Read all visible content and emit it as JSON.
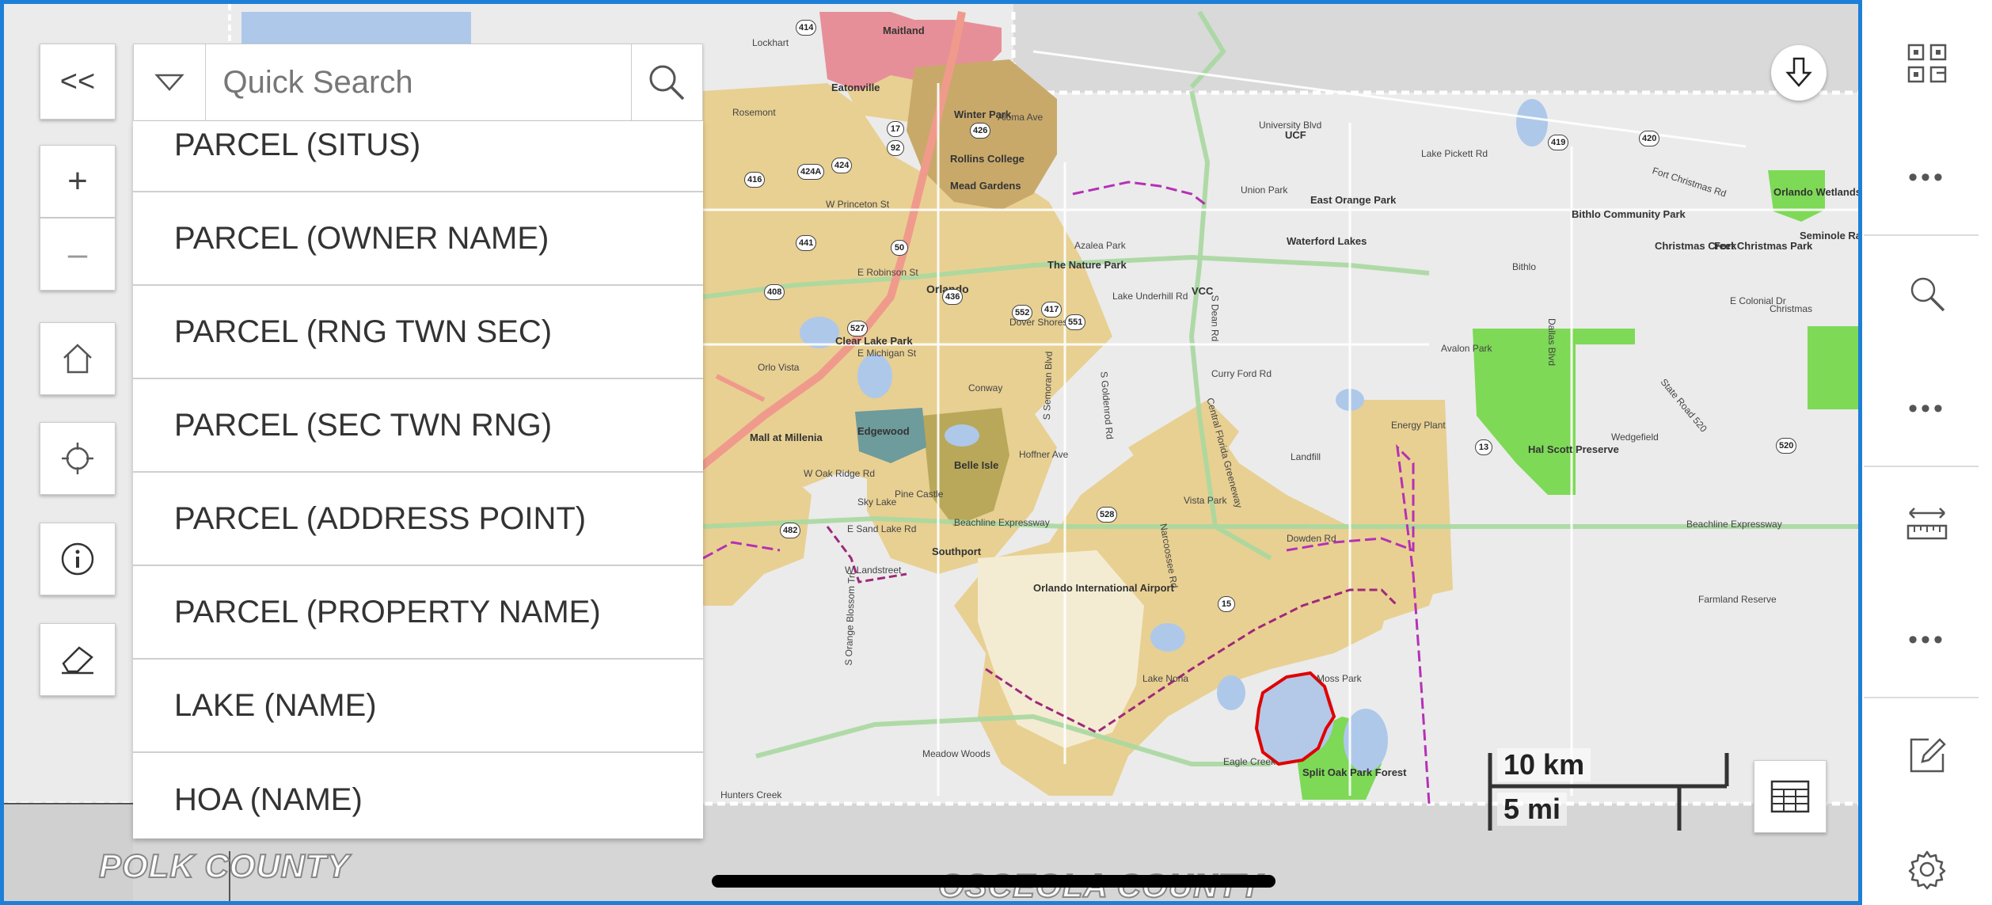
{
  "search": {
    "placeholder": "Quick Search",
    "items": [
      "PARCEL (SITUS)",
      "PARCEL (OWNER NAME)",
      "PARCEL (RNG TWN SEC)",
      "PARCEL (SEC TWN RNG)",
      "PARCEL (ADDRESS POINT)",
      "PARCEL (PROPERTY NAME)",
      "LAKE (NAME)",
      "HOA (NAME)"
    ]
  },
  "map_controls": {
    "collapse_label": "<<",
    "zoom_in_label": "+",
    "zoom_out_label": "–"
  },
  "map": {
    "counties": [
      "POLK COUNTY",
      "OSCEOLA COUNTY"
    ],
    "places": [
      "Maitland",
      "Eatonville",
      "Winter Park",
      "Rollins College",
      "Mead Gardens",
      "Orlando",
      "Clear Lake Park",
      "Edgewood",
      "Belle Isle",
      "Mall at Millenia",
      "The Nature Park",
      "Azalea Park",
      "Union Park",
      "East Orange Park",
      "Waterford Lakes",
      "Bithlo",
      "Bithlo Community Park",
      "Christmas",
      "Christmas Creek",
      "Fort Christmas Park",
      "Orlando Wetlands Park",
      "Seminole Ranch Conservation Area",
      "Hal Scott Preserve",
      "Wedgefield",
      "Orlando International Airport",
      "Southport",
      "Lake Nona",
      "Moss Park",
      "Split Oak Park Forest",
      "Eagle Creek",
      "Meadow Woods",
      "Landfill",
      "Vista Park",
      "Energy Plant",
      "Farmland Reserve",
      "Hunters Creek",
      "Avalon Park",
      "Lockhart",
      "Rosemont",
      "Conway",
      "UCF",
      "VCC",
      "Orlo Vista",
      "Dover Shores",
      "Pine Castle",
      "Sky Lake"
    ],
    "roads": [
      "University Blvd",
      "Lake Pickett Rd",
      "Fort Christmas Rd",
      "E Colonial Dr",
      "E Robinson St",
      "E Michigan St",
      "Lake Underhill Rd",
      "Curry Ford Rd",
      "Hoffner Ave",
      "W Oak Ridge Rd",
      "E Sand Lake Rd",
      "W Landstreet",
      "Beachline Expressway",
      "Dowden Rd",
      "Aloma Ave",
      "W Princeton St",
      "State Road 520",
      "Dallas Blvd",
      "S Dean Rd",
      "Narcoossee Rd",
      "S Orange Blossom Trl",
      "S Semoran Blvd",
      "S Goldenrod Rd",
      "Central Florida Greeneway"
    ],
    "route_shields": [
      "414",
      "17",
      "92",
      "426",
      "416",
      "424A",
      "424",
      "441",
      "408",
      "50",
      "436",
      "552",
      "551",
      "417",
      "527",
      "528",
      "482",
      "15",
      "13",
      "520",
      "419",
      "420"
    ]
  },
  "scale": {
    "km_label": "10 km",
    "mi_label": "5 mi"
  },
  "colors": {
    "frame_border": "#1e7fd6",
    "city_limits": "#e8cf8e",
    "parks": "#7ed957",
    "water": "#aec8ea",
    "selection_outline": "#e00000",
    "boundary_dash": "#a0287a"
  },
  "right_panel": {
    "icons": [
      "qr-code-icon",
      "more-icon",
      "search-icon",
      "more-icon",
      "measure-icon",
      "more-icon",
      "edit-note-icon",
      "settings-icon"
    ],
    "more_label": "•••"
  }
}
